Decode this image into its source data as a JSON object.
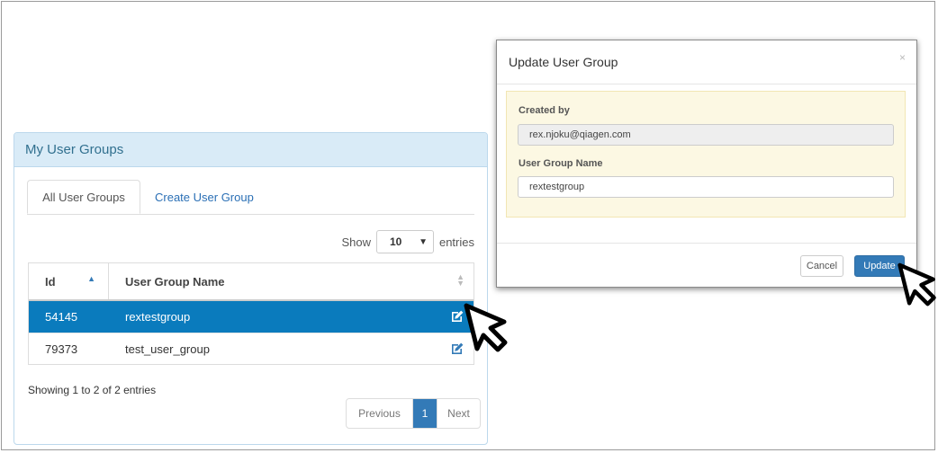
{
  "panel": {
    "title": "My User Groups",
    "tabs": [
      {
        "label": "All User Groups",
        "active": true
      },
      {
        "label": "Create User Group",
        "active": false
      }
    ],
    "length_menu": {
      "prefix": "Show",
      "selected": "10",
      "suffix": "entries"
    },
    "table": {
      "columns": [
        "Id",
        "User Group Name"
      ],
      "rows": [
        {
          "id": "54145",
          "name": "rextestgroup",
          "selected": true
        },
        {
          "id": "79373",
          "name": "test_user_group",
          "selected": false
        }
      ]
    },
    "info": "Showing 1 to 2 of 2 entries",
    "pagination": {
      "previous": "Previous",
      "current": "1",
      "next": "Next"
    }
  },
  "modal": {
    "title": "Update User Group",
    "close_symbol": "×",
    "created_by_label": "Created by",
    "created_by_value": "rex.njoku@qiagen.com",
    "group_name_label": "User Group Name",
    "group_name_value": "rextestgroup",
    "cancel_label": "Cancel",
    "update_label": "Update"
  },
  "colors": {
    "selected_row": "#0a7bbd",
    "primary": "#337ab7",
    "panel_heading": "#d9ebf7",
    "well": "#fcf8e3"
  },
  "icons": {
    "edit": "edit-icon",
    "cursor": "pointer-cursor-icon"
  }
}
